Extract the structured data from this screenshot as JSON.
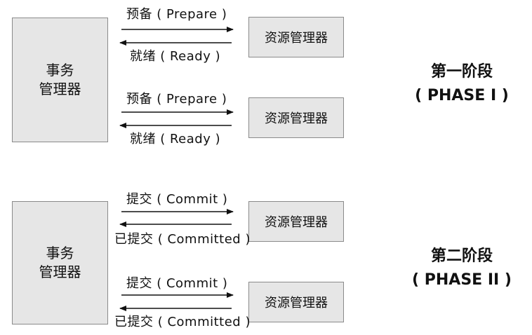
{
  "transaction_manager_label": [
    "事务",
    "管理器"
  ],
  "resource_manager_label": "资源管理器",
  "phase1": {
    "title": "第一阶段",
    "subtitle": "( PHASE I )",
    "request_label": "预备 ( Prepare )",
    "response_label": "就绪 ( Ready )"
  },
  "phase2": {
    "title": "第二阶段",
    "subtitle": "( PHASE II )",
    "request_label": "提交 ( Commit )",
    "response_label": "已提交 ( Committed )"
  }
}
